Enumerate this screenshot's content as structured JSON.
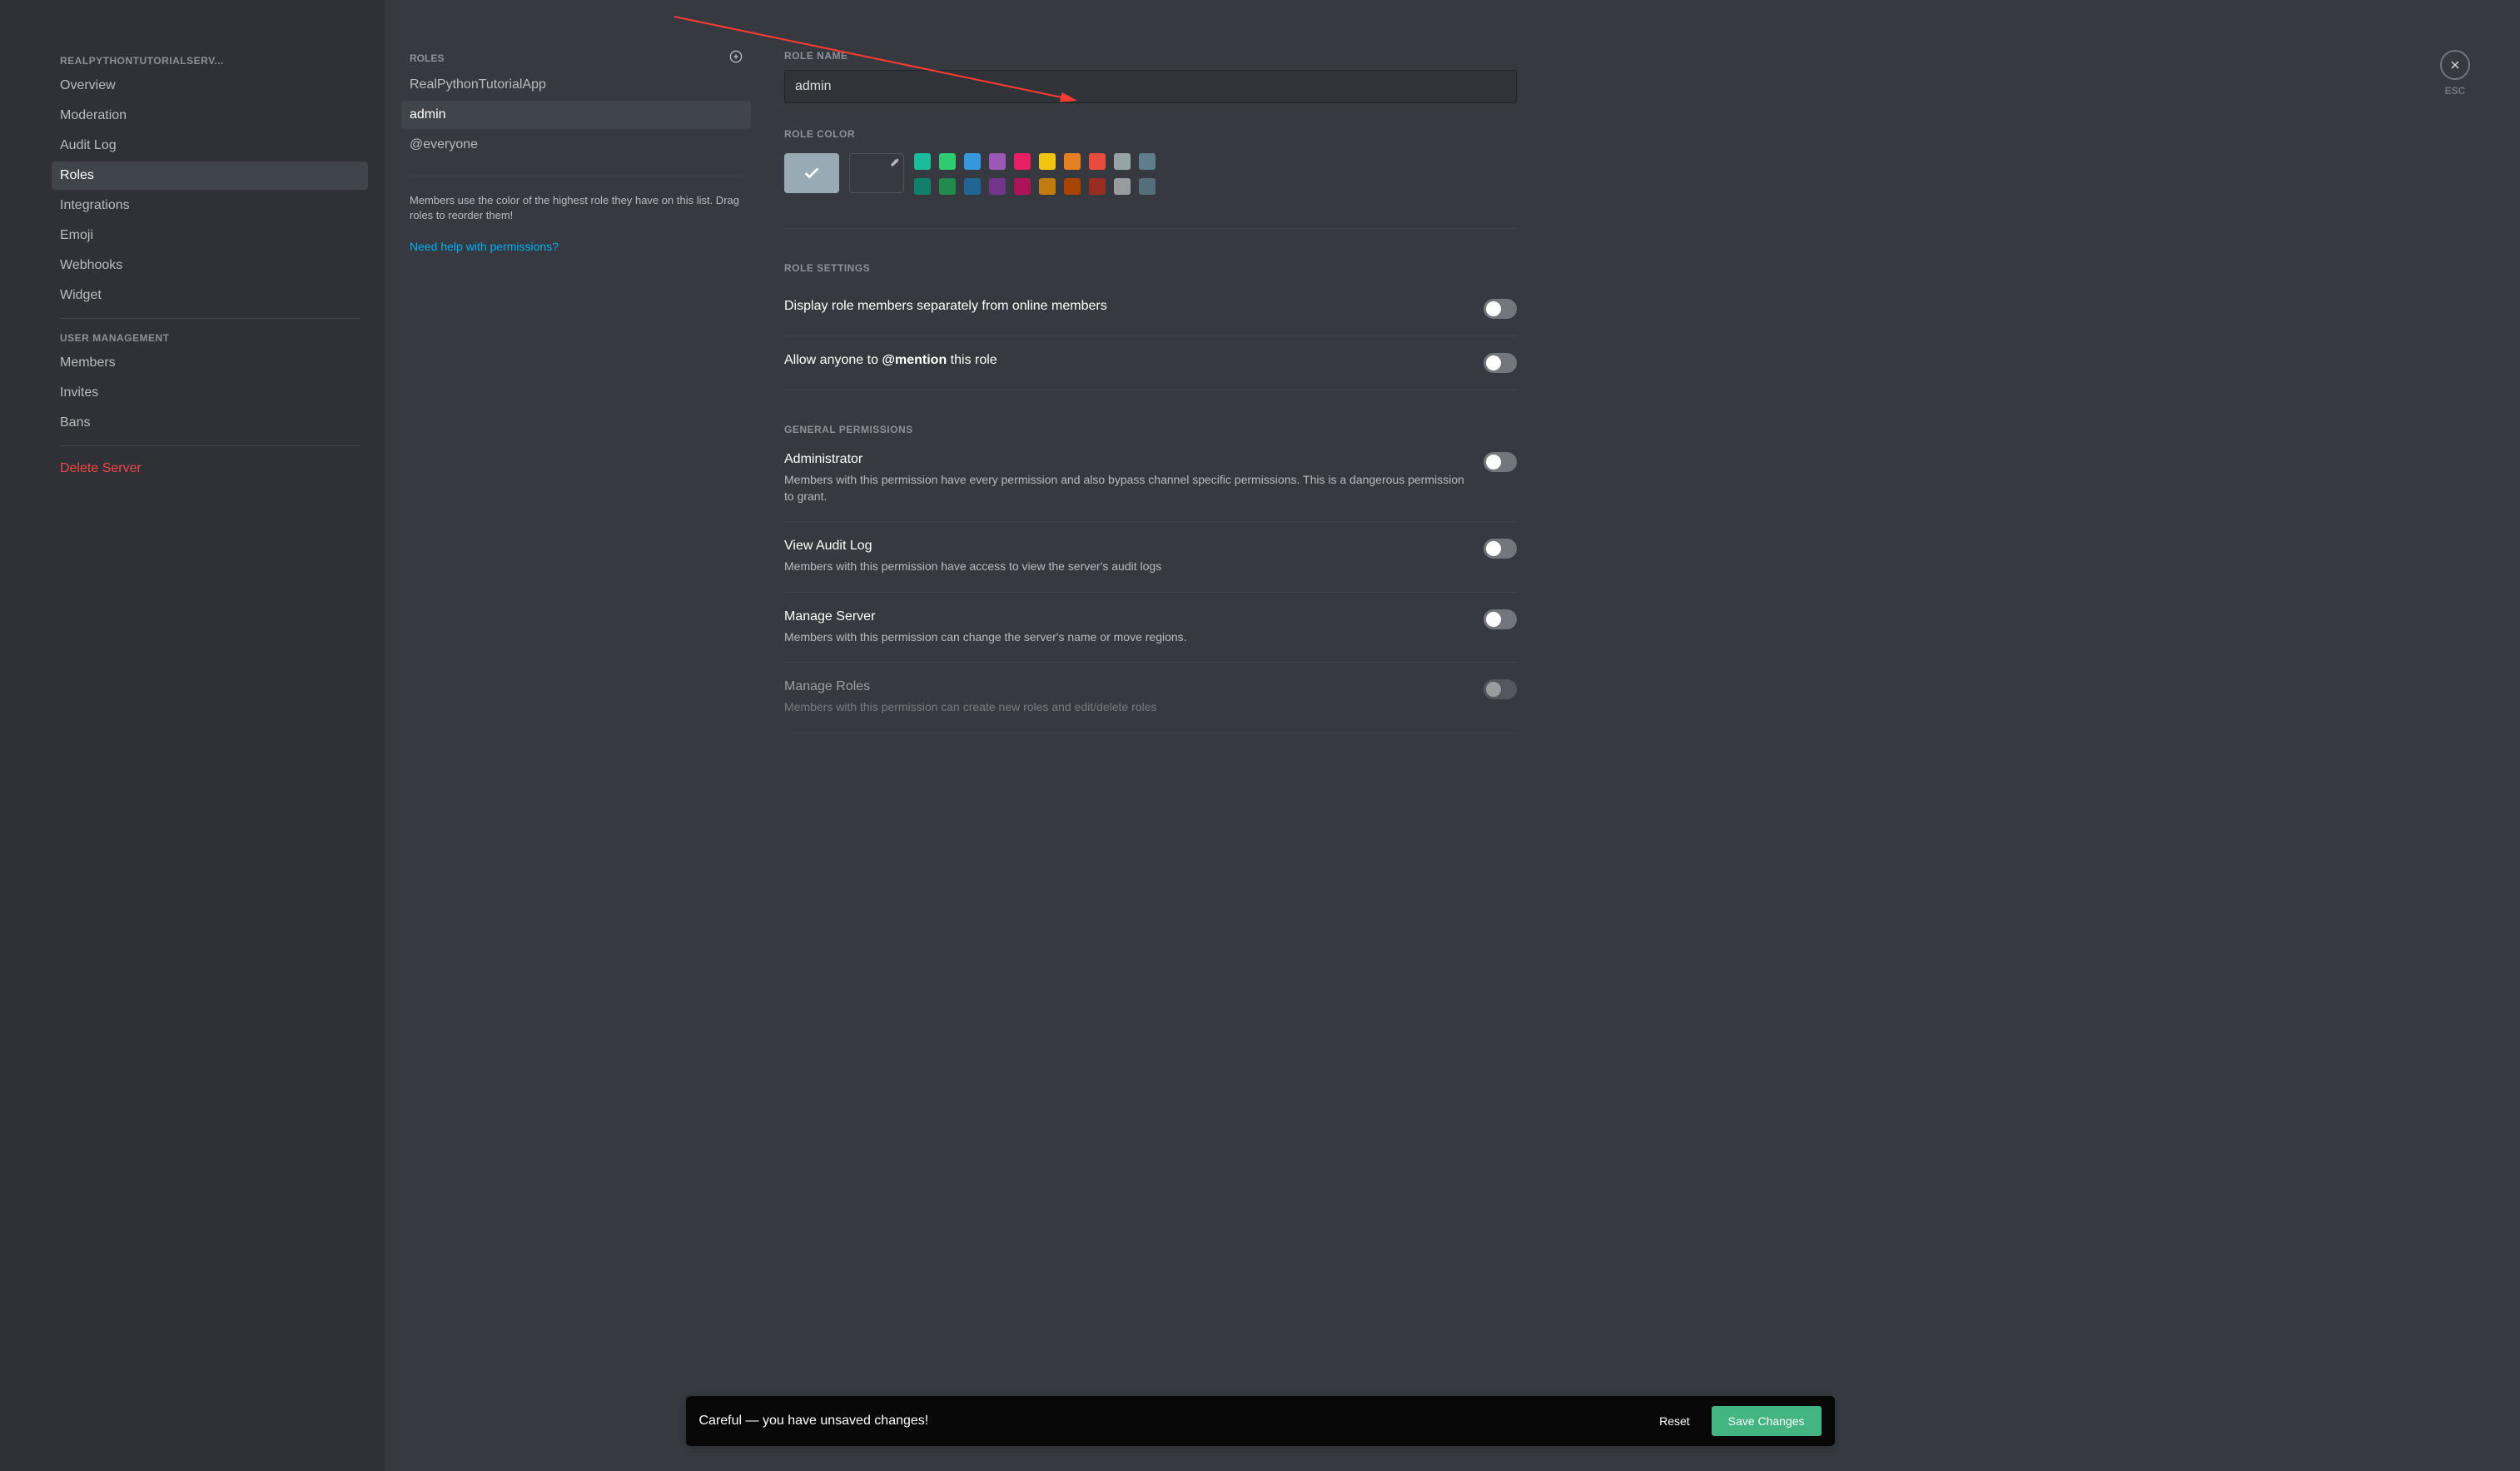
{
  "sidebar": {
    "server_name": "REALPYTHONTUTORIALSERV...",
    "items_server": [
      "Overview",
      "Moderation",
      "Audit Log",
      "Roles",
      "Integrations",
      "Emoji",
      "Webhooks",
      "Widget"
    ],
    "user_mgmt_header": "User Management",
    "items_user": [
      "Members",
      "Invites",
      "Bans"
    ],
    "delete_server": "Delete Server",
    "selected_index": 3
  },
  "mid": {
    "title": "Roles",
    "roles": [
      "RealPythonTutorialApp",
      "admin",
      "@everyone"
    ],
    "selected_index": 1,
    "hint": "Members use the color of the highest role they have on this list. Drag roles to reorder them!",
    "help_link": "Need help with permissions?"
  },
  "main": {
    "role_name_label": "Role Name",
    "role_name_value": "admin",
    "role_color_label": "Role Color",
    "default_color": "#99aab5",
    "palette_top": [
      "#1abc9c",
      "#2ecc71",
      "#3498db",
      "#9b59b6",
      "#e91e63",
      "#f1c40f",
      "#e67e22",
      "#e74c3c",
      "#95a5a6",
      "#607d8b"
    ],
    "palette_bottom": [
      "#11806a",
      "#1f8b4c",
      "#206694",
      "#71368a",
      "#ad1457",
      "#c27c0e",
      "#a84300",
      "#992d22",
      "#979c9f",
      "#546e7a"
    ],
    "role_settings_header": "Role Settings",
    "display_separately_label": "Display role members separately from online members",
    "allow_mention_prefix": "Allow anyone to ",
    "allow_mention_bold": "@mention",
    "allow_mention_suffix": " this role",
    "general_perms_header": "General Permissions",
    "perm_admin_title": "Administrator",
    "perm_admin_desc": "Members with this permission have every permission and also bypass channel specific permissions. This is a dangerous permission to grant.",
    "perm_audit_title": "View Audit Log",
    "perm_audit_desc": "Members with this permission have access to view the server's audit logs",
    "perm_manage_server_title": "Manage Server",
    "perm_manage_server_desc": "Members with this permission can change the server's name or move regions.",
    "perm_manage_roles_title": "Manage Roles",
    "perm_manage_roles_desc": "Members with this permission can create new roles and edit/delete roles"
  },
  "close": {
    "esc": "ESC"
  },
  "unsaved": {
    "message": "Careful — you have unsaved changes!",
    "reset": "Reset",
    "save": "Save Changes"
  }
}
